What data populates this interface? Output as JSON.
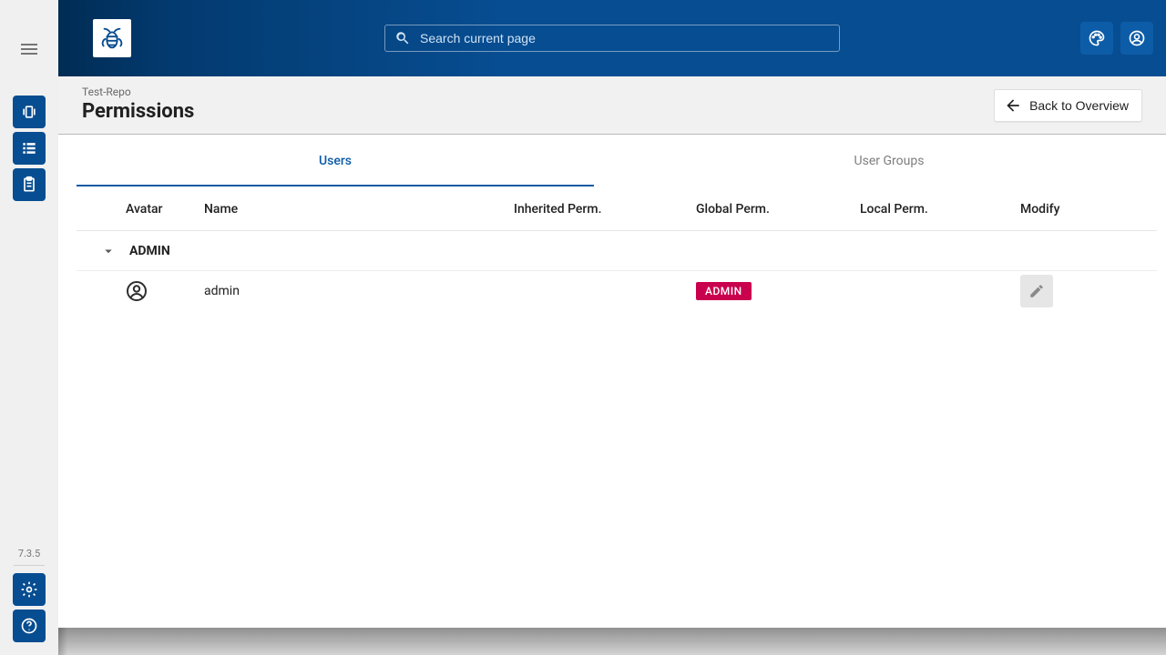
{
  "sidebar": {
    "version": "7.3.5"
  },
  "header": {
    "search_placeholder": "Search current page"
  },
  "page": {
    "breadcrumb": "Test-Repo",
    "title": "Permissions",
    "back_label": "Back to Overview"
  },
  "tabs": {
    "users": "Users",
    "groups": "User Groups"
  },
  "columns": {
    "avatar": "Avatar",
    "name": "Name",
    "inherited": "Inherited Perm.",
    "global": "Global Perm.",
    "local": "Local Perm.",
    "modify": "Modify"
  },
  "group": {
    "admin_label": "ADMIN"
  },
  "rows": {
    "admin": {
      "name": "admin",
      "global_badge": "ADMIN"
    }
  },
  "colors": {
    "brand_blue": "#074D91",
    "badge_pink": "#c9004d"
  }
}
